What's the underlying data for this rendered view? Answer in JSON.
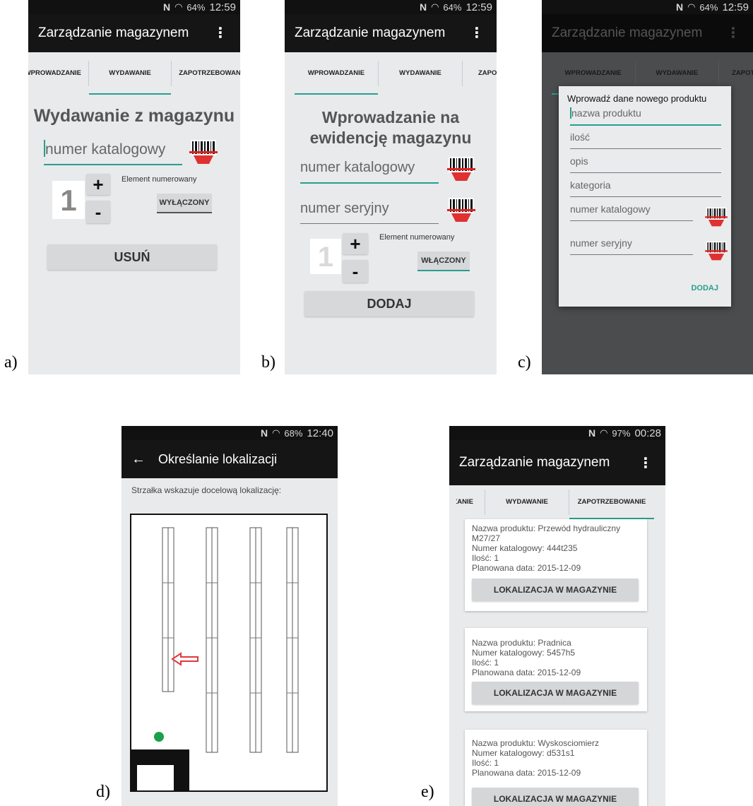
{
  "labels": [
    "a)",
    "b)",
    "c)",
    "d)",
    "e)"
  ],
  "status": {
    "a": {
      "nfc": "N",
      "battery": "64%",
      "time": "12:59"
    },
    "b": {
      "nfc": "N",
      "battery": "64%",
      "time": "12:59"
    },
    "c": {
      "nfc": "N",
      "battery": "64%",
      "time": "12:59"
    },
    "d": {
      "nfc": "N",
      "battery": "68%",
      "time": "12:40"
    },
    "e": {
      "nfc": "N",
      "battery": "97%",
      "time": "00:28"
    }
  },
  "app_title": "Zarządzanie magazynem",
  "menu_icon": "⋮",
  "panel_a": {
    "tabs": [
      "WPROWADZANIE",
      "WYDAWANIE",
      "ZAPOTRZEBOWANIE"
    ],
    "heading": "Wydawanie z magazynu",
    "catalog_placeholder": "numer katalogowy",
    "qty": "1",
    "plus": "+",
    "minus": "-",
    "numbered_label": "Element numerowany",
    "toggle": "WYŁĄCZONY",
    "action": "USUŃ"
  },
  "panel_b": {
    "tabs": [
      "WPROWADZANIE",
      "WYDAWANIE",
      "ZAPOTRZEBOWANIE"
    ],
    "heading_line1": "Wprowadzanie na",
    "heading_line2": "ewidencję magazynu",
    "catalog_placeholder": "numer katalogowy",
    "serial_placeholder": "numer seryjny",
    "qty": "1",
    "plus": "+",
    "minus": "-",
    "numbered_label": "Element numerowany",
    "toggle": "WŁĄCZONY",
    "action": "DODAJ"
  },
  "panel_c": {
    "tabs": [
      "WPROWADZANIE",
      "WYDAWANIE",
      "ZAPOTRZEBOWANIE"
    ],
    "dialog_title": "Wprowadź dane nowego produktu",
    "fields": [
      "nazwa produktu",
      "ilość",
      "opis",
      "kategoria",
      "numer katalogowy",
      "numer seryjny"
    ],
    "action": "DODAJ"
  },
  "panel_d": {
    "back_icon": "←",
    "title": "Określanie lokalizacji",
    "hint": "Strzałka wskazuje docelową lokalizację:"
  },
  "panel_e": {
    "tabs": [
      "WPROWADZANIE",
      "WYDAWANIE",
      "ZAPOTRZEBOWANIE"
    ],
    "cards": [
      {
        "name_l1": "Nazwa produktu: Przewód hydrauliczny",
        "name_l2": "M27/27",
        "catalog": "Numer katalogowy: 444t235",
        "qty": "Ilość: 1",
        "date": "Planowana data: 2015-12-09",
        "button": "LOKALIZACJA W MAGAZYNIE"
      },
      {
        "name_l1": "Nazwa produktu: Pradnica",
        "name_l2": "",
        "catalog": "Numer katalogowy: 5457h5",
        "qty": "Ilość: 1",
        "date": "Planowana data: 2015-12-09",
        "button": "LOKALIZACJA W MAGAZYNIE"
      },
      {
        "name_l1": "Nazwa produktu: Wyskosciomierz",
        "name_l2": "",
        "catalog": "Numer katalogowy: d531s1",
        "qty": "Ilość: 1",
        "date": "Planowana data: 2015-12-09",
        "button": "LOKALIZACJA W MAGAZYNIE"
      }
    ]
  },
  "colors": {
    "accent": "#2a9d8f",
    "appbar": "#151515",
    "screen": "#e8eaec",
    "arrow": "#e0383a",
    "marker": "#1aa04a"
  }
}
